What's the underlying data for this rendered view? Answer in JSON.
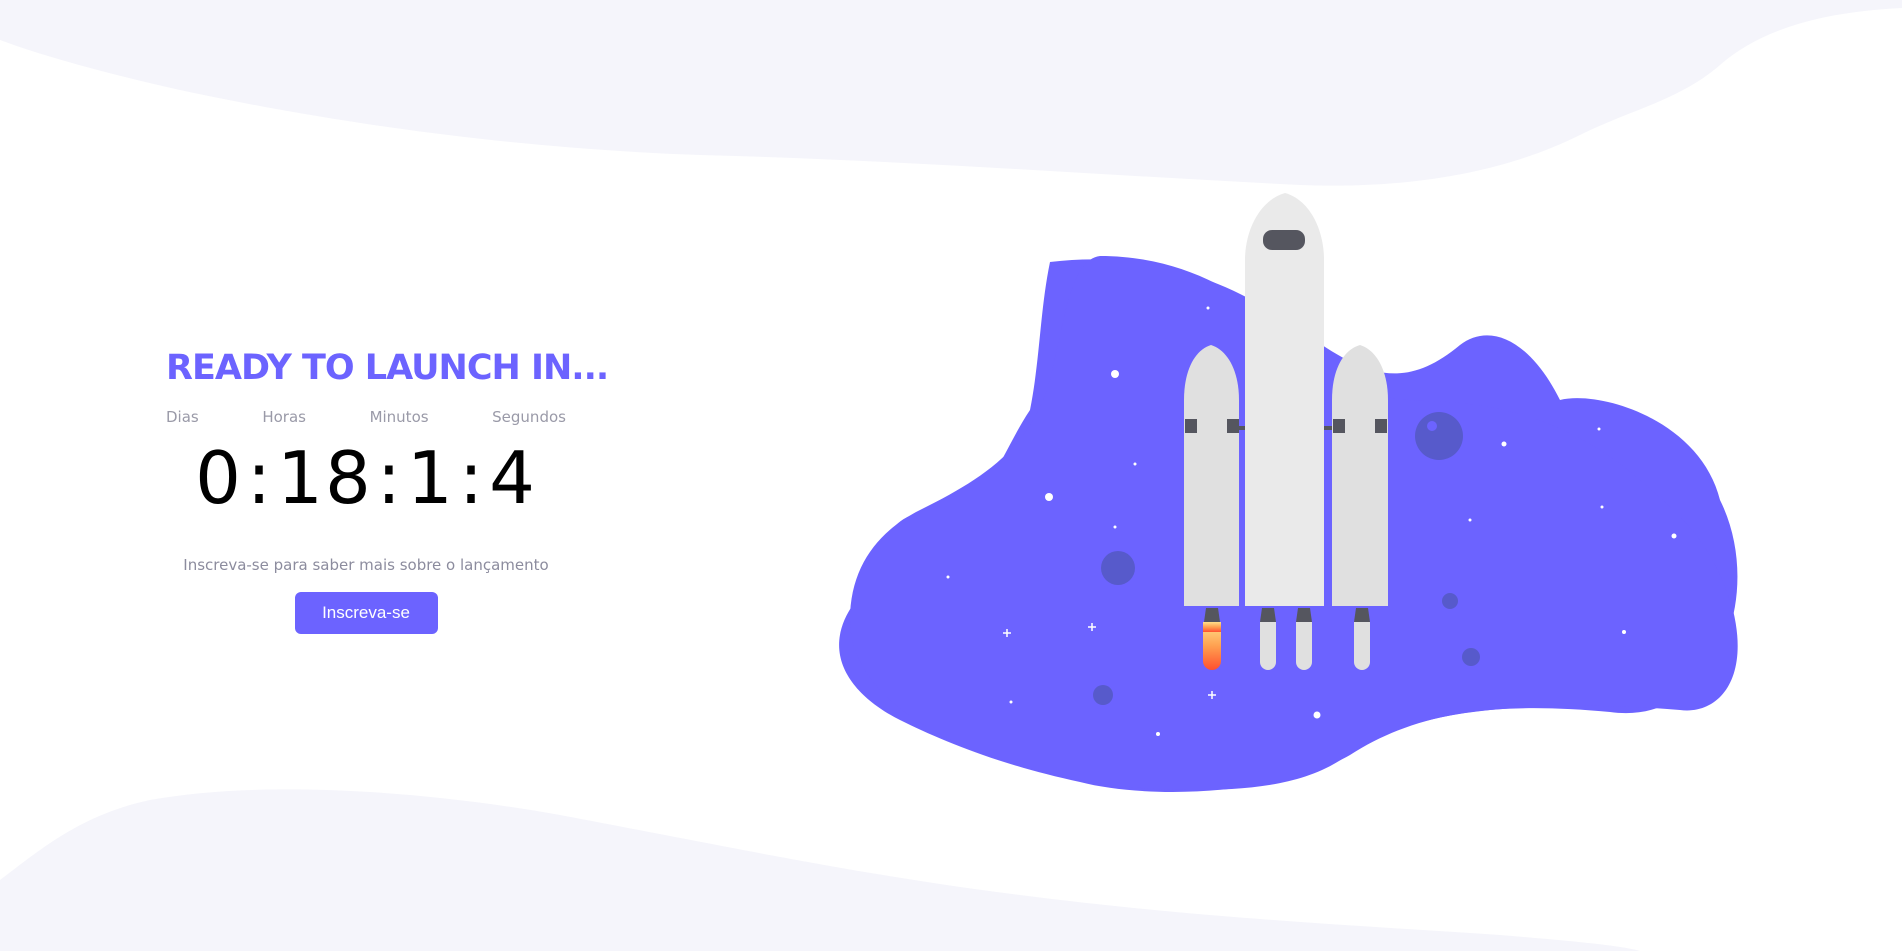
{
  "hero": {
    "title": "READY TO LAUNCH IN..."
  },
  "countdown": {
    "labels": {
      "days": "Dias",
      "hours": "Horas",
      "minutes": "Minutos",
      "seconds": "Segundos"
    },
    "values": {
      "days": "0",
      "hours": "18",
      "minutes": "1",
      "seconds": "4"
    },
    "separator": ":"
  },
  "subscribe": {
    "text": "Inscreva-se para saber mais sobre o lançamento",
    "button_label": "Inscreva-se"
  },
  "colors": {
    "accent": "#6c63ff",
    "background_wave": "#f5f5fb",
    "rocket_body": "#e6e6e6",
    "rocket_window": "#4b4b57"
  },
  "illustration": {
    "icon": "rocket-launch-illustration"
  }
}
